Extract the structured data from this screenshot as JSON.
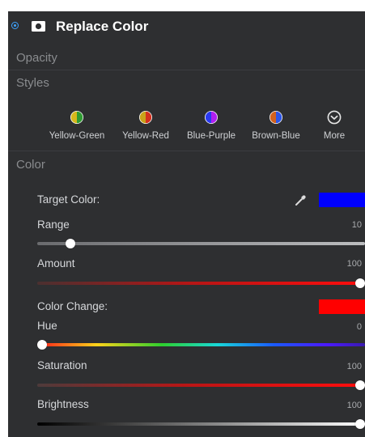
{
  "panel": {
    "title": "Replace Color",
    "sections": {
      "opacity": "Opacity",
      "styles": "Styles",
      "color": "Color"
    }
  },
  "styles": [
    {
      "label": "Yellow-Green",
      "icon": "yellow-green-swatch-icon"
    },
    {
      "label": "Yellow-Red",
      "icon": "yellow-red-swatch-icon"
    },
    {
      "label": "Blue-Purple",
      "icon": "blue-purple-swatch-icon"
    },
    {
      "label": "Brown-Blue",
      "icon": "brown-blue-swatch-icon"
    },
    {
      "label": "More",
      "icon": "chevron-down-circle-icon"
    }
  ],
  "color": {
    "target_label": "Target Color:",
    "target_color": "#0000ff",
    "change_label": "Color Change:",
    "change_color": "#ff0000",
    "sliders": {
      "range": {
        "label": "Range",
        "value": "10",
        "fraction": 0.1
      },
      "amount": {
        "label": "Amount",
        "value": "100",
        "fraction": 1.0
      },
      "hue": {
        "label": "Hue",
        "value": "0",
        "fraction": 0.0
      },
      "saturation": {
        "label": "Saturation",
        "value": "100",
        "fraction": 1.0
      },
      "brightness": {
        "label": "Brightness",
        "value": "100",
        "fraction": 1.0
      }
    }
  },
  "colors": {
    "panel_bg": "#2e2f31",
    "accent": "#3ea3ff"
  }
}
